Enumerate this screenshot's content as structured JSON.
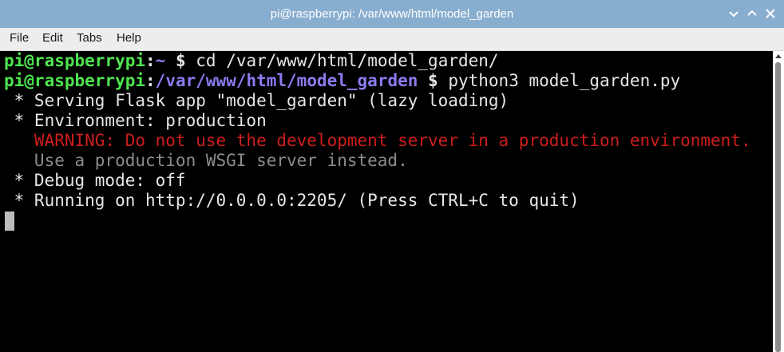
{
  "window": {
    "title": "pi@raspberrypi: /var/www/html/model_garden"
  },
  "menu": {
    "file": "File",
    "edit": "Edit",
    "tabs": "Tabs",
    "help": "Help"
  },
  "terminal": {
    "line1": {
      "user": "pi@raspberrypi",
      "sep": ":",
      "path": "~",
      "prompt": " $",
      "cmd": " cd /var/www/html/model_garden/"
    },
    "line2": {
      "user": "pi@raspberrypi",
      "sep": ":",
      "path": "/var/www/html/model_garden",
      "prompt": " $",
      "cmd": " python3 model_garden.py"
    },
    "line3": " * Serving Flask app \"model_garden\" (lazy loading)",
    "line4": " * Environment: production",
    "line5": "   WARNING: Do not use the development server in a production environment.",
    "line6": "   Use a production WSGI server instead.",
    "line7": " * Debug mode: off",
    "line8": " * Running on http://0.0.0.0:2205/ (Press CTRL+C to quit)"
  },
  "colors": {
    "titlebar": "#87adcf",
    "user": "#4ee44e",
    "path": "#8a7cf0",
    "warning": "#cd1d1d"
  },
  "icons": {
    "minimize": "minimize-icon",
    "maximize": "maximize-icon",
    "close": "close-icon"
  }
}
